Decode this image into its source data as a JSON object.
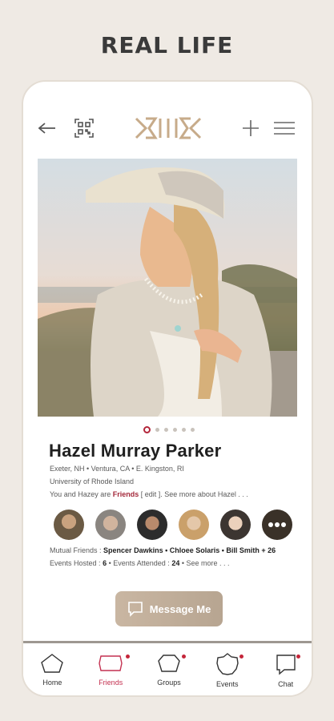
{
  "headline": "REAL LIFE",
  "profile": {
    "name": "Hazel Murray Parker",
    "locations": "Exeter, NH • Ventura, CA • E. Kingston, RI",
    "school": "University of Rhode Island",
    "relation_prefix": "You and Hazey are",
    "relation_status": "Friends",
    "relation_suffix": "[ edit ]. See more about Hazel . . ."
  },
  "mutual": {
    "label": "Mutual Friends :",
    "names": "Spencer Dawkins • Chloee Solaris • Bill Smith + 26"
  },
  "events": {
    "hosted_label": "Events Hosted :",
    "hosted_count": "6",
    "attended_label": "• Events Attended :",
    "attended_count": "24",
    "more": "• See more . . ."
  },
  "message_button": "Message Me",
  "nav": {
    "home": "Home",
    "friends": "Friends",
    "groups": "Groups",
    "events": "Events",
    "chat": "Chat"
  },
  "photo_carousel": {
    "active_index": 0,
    "count": 6
  },
  "colors": {
    "accent": "#b3263a",
    "brand": "#c7ab8a",
    "button": "#c2af9b"
  }
}
